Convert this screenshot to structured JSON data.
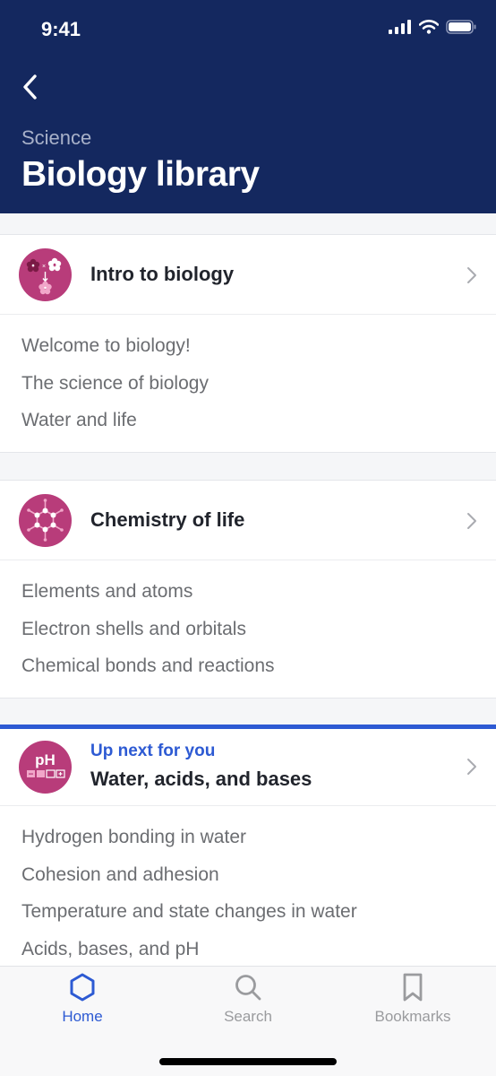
{
  "status_bar": {
    "time": "9:41"
  },
  "header": {
    "subject": "Science",
    "title": "Biology library"
  },
  "units": [
    {
      "title": "Intro to biology",
      "icon": "flower-cross-icon",
      "lessons": [
        "Welcome to biology!",
        "The science of biology",
        "Water and life"
      ]
    },
    {
      "title": "Chemistry of life",
      "icon": "molecule-icon",
      "lessons": [
        "Elements and atoms",
        "Electron shells and orbitals",
        "Chemical bonds and reactions"
      ]
    },
    {
      "kicker": "Up next for you",
      "title": "Water, acids, and bases",
      "icon": "ph-scale-icon",
      "icon_text": "pH",
      "lessons": [
        "Hydrogen bonding in water",
        "Cohesion and adhesion",
        "Temperature and state changes in water",
        "Acids, bases, and pH"
      ]
    }
  ],
  "tabbar": {
    "tabs": [
      {
        "label": "Home",
        "icon": "hexagon-home-icon",
        "active": true
      },
      {
        "label": "Search",
        "icon": "search-icon",
        "active": false
      },
      {
        "label": "Bookmarks",
        "icon": "bookmark-icon",
        "active": false
      }
    ]
  },
  "colors": {
    "header_bg": "#14285f",
    "accent": "#2d5ad3",
    "badge": "#b83c7a"
  }
}
